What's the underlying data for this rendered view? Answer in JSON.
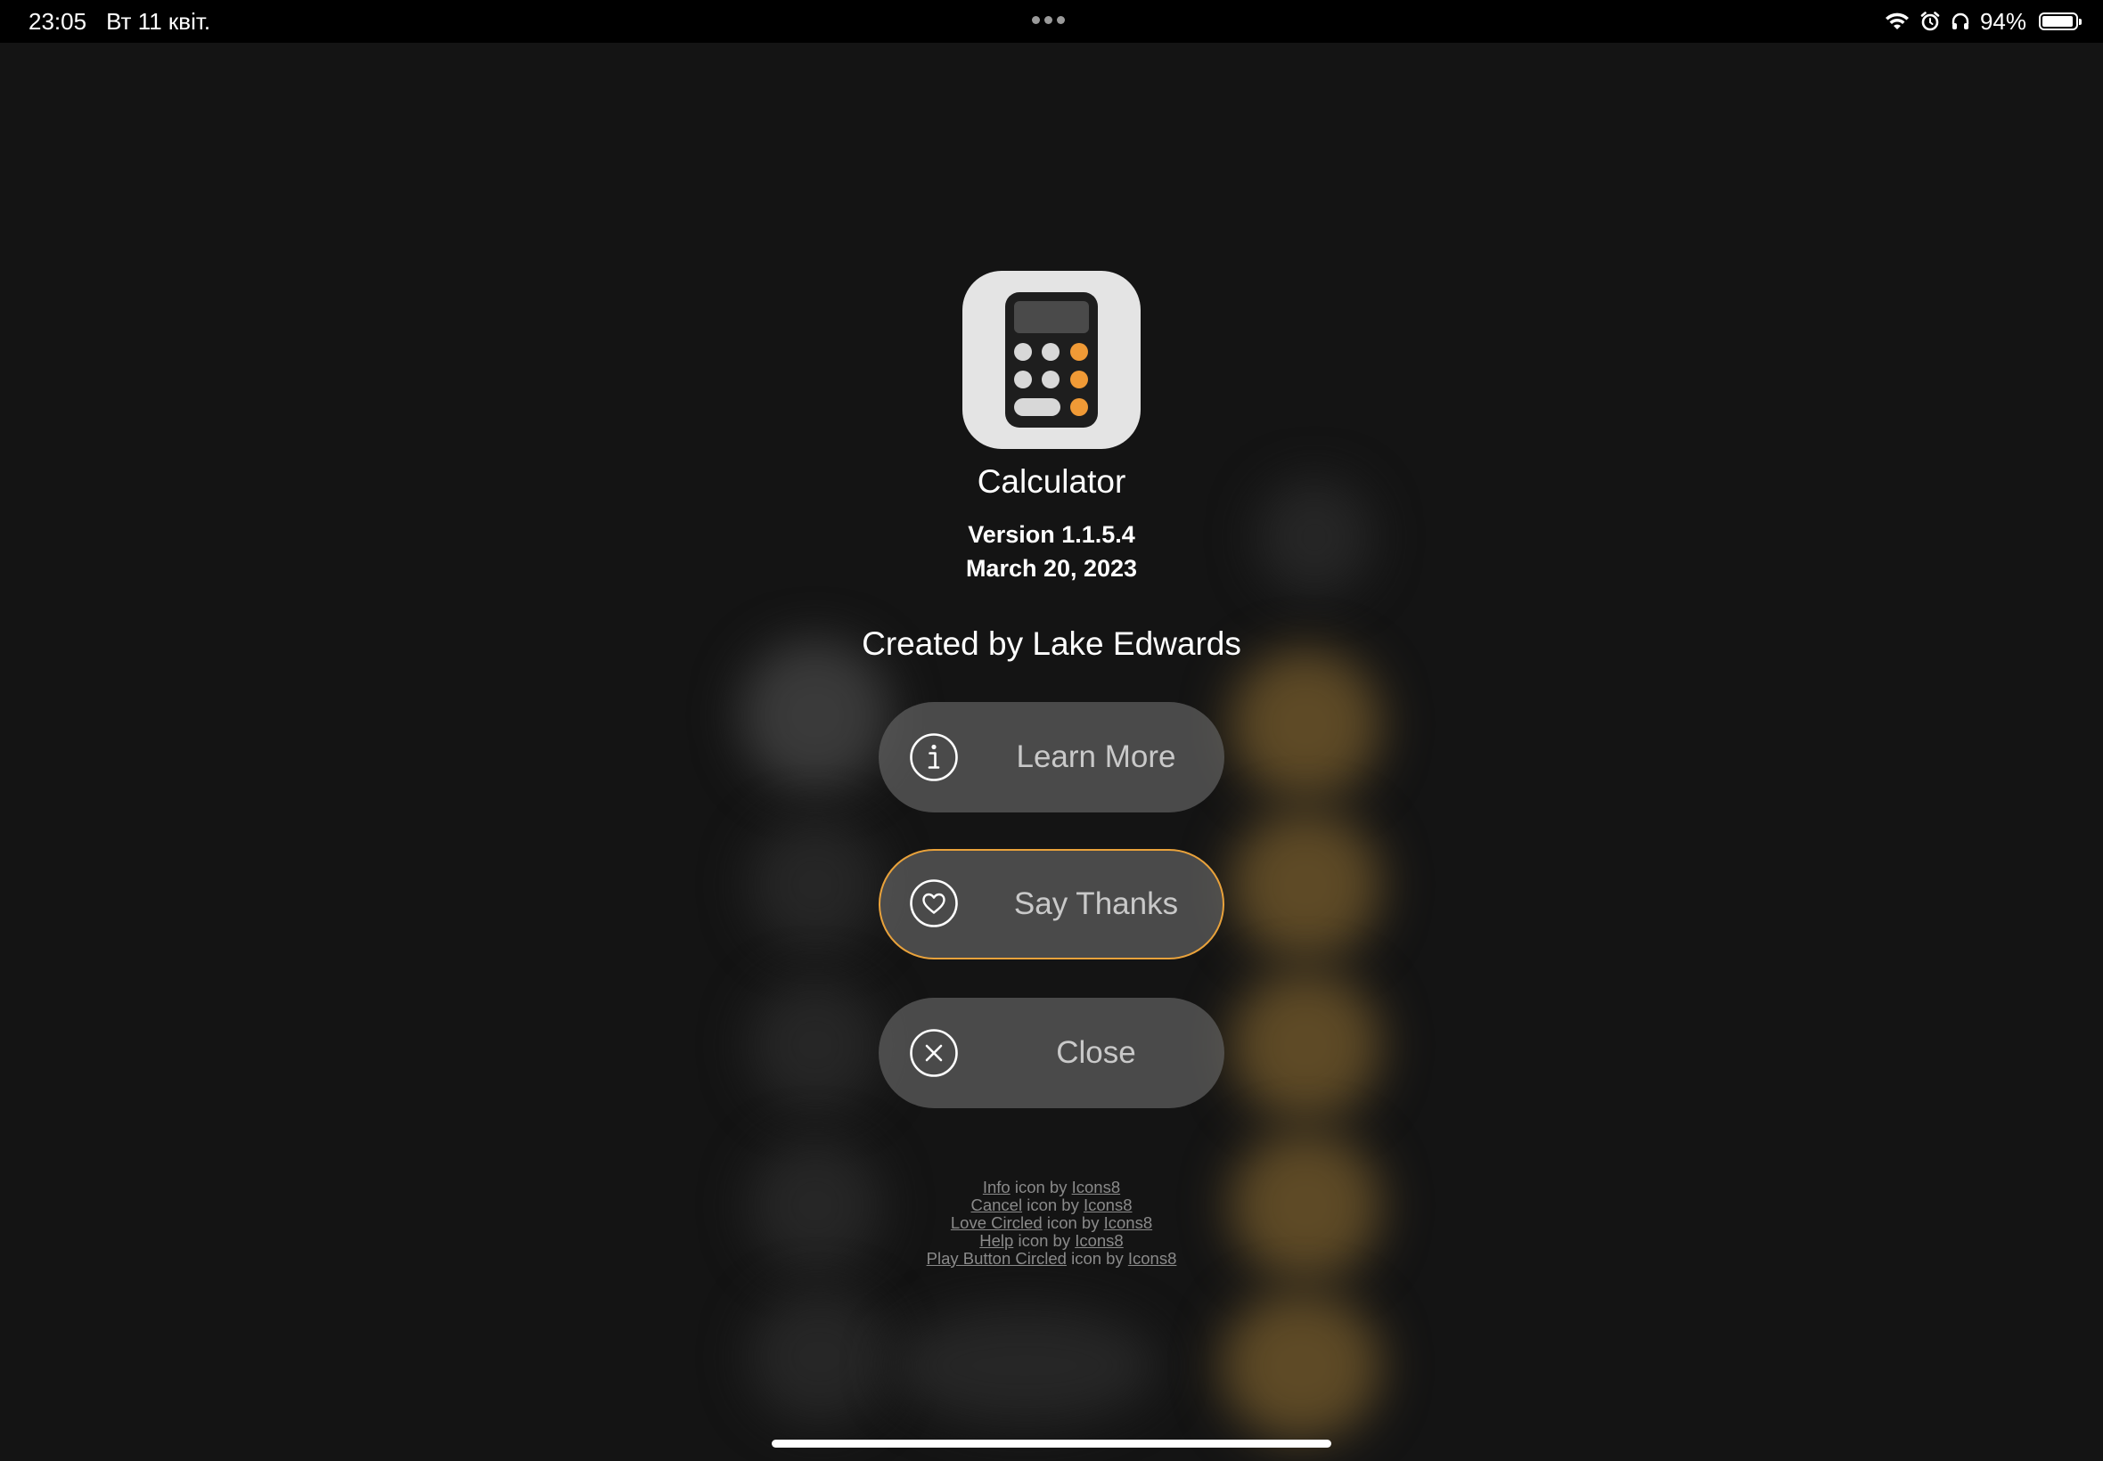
{
  "status_bar": {
    "time": "23:05",
    "date": "Вт 11 квіт.",
    "battery_percent": "94%",
    "battery_level": 0.94,
    "icons": [
      "wifi-icon",
      "alarm-icon",
      "headphones-icon",
      "battery-icon"
    ]
  },
  "app": {
    "name": "Calculator",
    "version": "Version 1.1.5.4",
    "release_date": "March 20, 2023",
    "credits": "Created by Lake Edwards",
    "icon": "calculator-icon"
  },
  "buttons": {
    "learn_more": {
      "label": "Learn More",
      "icon": "info-icon"
    },
    "say_thanks": {
      "label": "Say Thanks",
      "icon": "heart-icon"
    },
    "close": {
      "label": "Close",
      "icon": "close-icon"
    }
  },
  "attributions": [
    {
      "link": "Info",
      "middle": " icon by ",
      "author": "Icons8"
    },
    {
      "link": "Cancel",
      "middle": " icon by ",
      "author": "Icons8"
    },
    {
      "link": "Love Circled",
      "middle": " icon by ",
      "author": "Icons8"
    },
    {
      "link": "Help",
      "middle": " icon by ",
      "author": "Icons8"
    },
    {
      "link": "Play Button Circled",
      "middle": " icon by ",
      "author": "Icons8"
    }
  ],
  "colors": {
    "background": "#141414",
    "accent": "#e9a23b",
    "button_fill": "#5f5f5f",
    "button_text": "#c9c9c9"
  }
}
